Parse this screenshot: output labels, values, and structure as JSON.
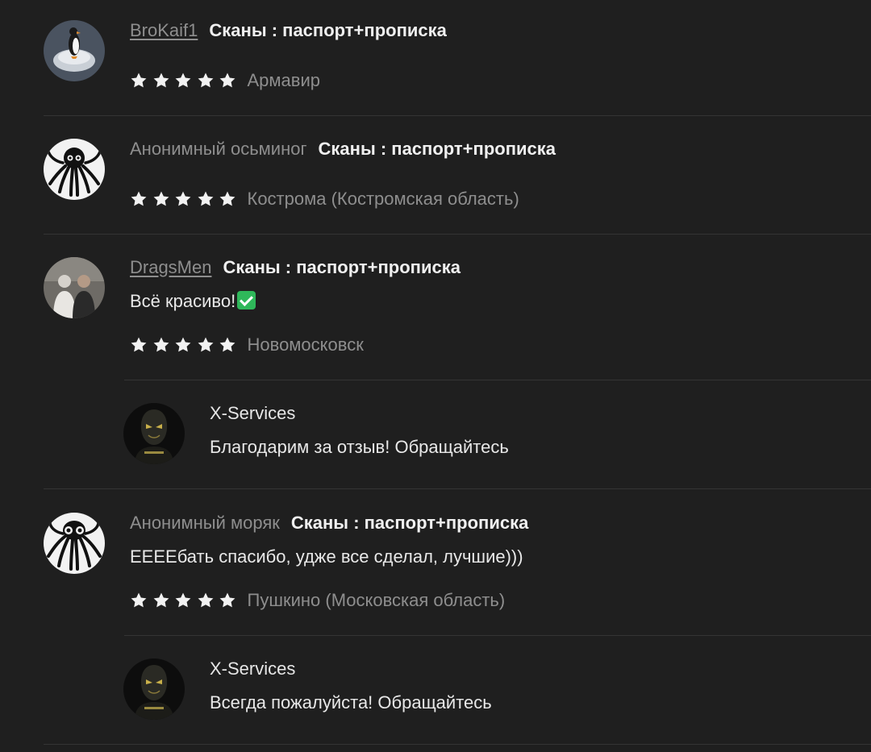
{
  "reviews": [
    {
      "author": "BroKaif1",
      "product": "Сканы : паспорт+прописка",
      "text": "",
      "rating": 5,
      "city": "Армавир"
    },
    {
      "author": "Анонимный осьминог",
      "product": "Сканы : паспорт+прописка",
      "text": "",
      "rating": 5,
      "city": "Кострома (Костромская область)"
    },
    {
      "author": "DragsMen",
      "product": "Сканы : паспорт+прописка",
      "text": "Всё красиво!",
      "rating": 5,
      "city": "Новомосковск",
      "reply": {
        "author": "X-Services",
        "text": "Благодарим за отзыв! Обращайтесь"
      }
    },
    {
      "author": "Анонимный моряк",
      "product": "Сканы : паспорт+прописка",
      "text": "ЕЕЕЕбать спасибо, удже все сделал, лучшие)))",
      "rating": 5,
      "city": "Пушкино (Московская область)",
      "reply": {
        "author": "X-Services",
        "text": "Всегда пожалуйста! Обращайтесь"
      }
    }
  ],
  "colors": {
    "background": "#1f1f1f",
    "star": "#f2f2f2",
    "muted_text": "#8e8e8e",
    "divider": "#343434",
    "check_emoji": "#2fb85a"
  },
  "icons": {
    "star": "star-icon",
    "check": "check-mark-emoji-icon"
  }
}
